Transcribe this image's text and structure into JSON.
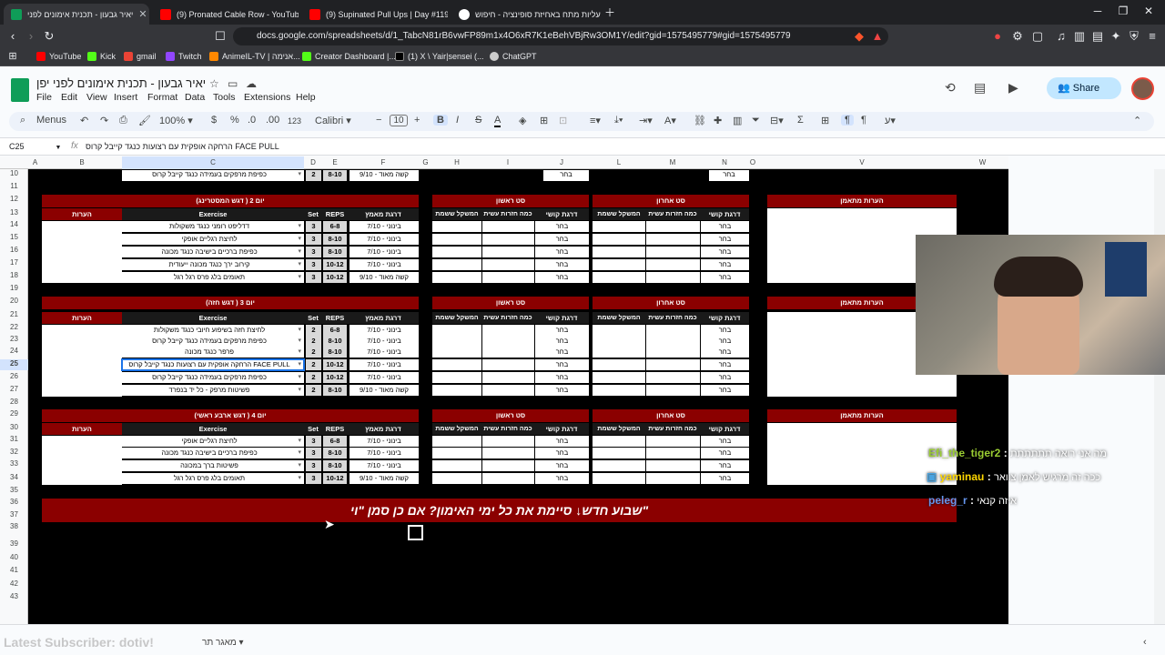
{
  "browser": {
    "tabs": [
      {
        "title": "יאיר גבעון - תכנית אימונים לפני",
        "color": "#0f9d58"
      },
      {
        "title": "(9) Pronated Cable Row - YouTube",
        "color": "#ff0000"
      },
      {
        "title": "(9) Supinated Pull Ups | Day #119 W",
        "color": "#ff0000"
      },
      {
        "title": "עליות מתח באחיזת סופינציה - חיפוש",
        "color": "#4285f4"
      }
    ],
    "url": "docs.google.com/spreadsheets/d/1_TabcN81rB6vwFP89m1x4O6xR7K1eBehVBjRw3OM1Y/edit?gid=1575495779#gid=1575495779",
    "bookmarks": [
      "YouTube",
      "Kick",
      "gmail",
      "Twitch",
      "AnimeIL-TV | אנימה...",
      "Creator Dashboard |...",
      "(1) X \\ Yair|sensei (...",
      "ChatGPT"
    ]
  },
  "sheets": {
    "title": "יאיר גבעון - תכנית אימונים לפני יפן",
    "menu": [
      "File",
      "Edit",
      "View",
      "Insert",
      "Format",
      "Data",
      "Tools",
      "Extensions",
      "Help"
    ],
    "share_label": "Share",
    "toolbar": {
      "menus": "Menus",
      "zoom": "100%",
      "currency": "$",
      "percent": "%",
      "dec1": ".0",
      "dec2": ".00",
      "num": "123",
      "font": "Calibri",
      "font_size": "10"
    },
    "cell_ref": "C25",
    "formula": "הרחקה אופקית עם רצועות כנגד קייבל קרוס FACE PULL",
    "columns": [
      "A",
      "B",
      "C",
      "D",
      "E",
      "F",
      "G",
      "H",
      "I",
      "J",
      "L",
      "M",
      "N",
      "O",
      "V",
      "W"
    ],
    "rows": [
      "10",
      "11",
      "12",
      "13",
      "14",
      "15",
      "16",
      "17",
      "18",
      "19",
      "20",
      "21",
      "22",
      "23",
      "24",
      "25",
      "26",
      "27",
      "28",
      "29",
      "30",
      "31",
      "32",
      "33",
      "34",
      "35",
      "36",
      "37",
      "38",
      "39",
      "40",
      "41",
      "42",
      "43"
    ],
    "headers": {
      "exercise": "Exercise",
      "set": "Set",
      "reps": "REPS",
      "effort": "דרגת מאמץ",
      "notes": "הערות",
      "first_set": "סט ראשון",
      "last_set": "סט אחרון",
      "weight": "המשקל ששמת",
      "reps_done": "כמה חזרות עשית",
      "difficulty": "דרגת קושי",
      "trainer_notes": "הערות מתאמן"
    },
    "row10": {
      "exercise": "כפיפת מרפקים בעמידה כנגד קייבל קרוס",
      "set": "2",
      "reps": "8-10",
      "effort": "קשה מאוד - 9/10",
      "choose": "בחר"
    },
    "day2": {
      "title": "יום 2 ( דגש המסטרינג)",
      "rows": [
        {
          "exercise": "דדליפט רומני כנגד משקולות",
          "set": "3",
          "reps": "6-8",
          "effort": "בינוני - 7/10",
          "choose": "בחר"
        },
        {
          "exercise": "לחיצת רגליים אופקי",
          "set": "3",
          "reps": "8-10",
          "effort": "בינוני - 7/10",
          "choose": "בחר"
        },
        {
          "exercise": "כפיפת ברכיים בישיבה כנגד מכונה",
          "set": "3",
          "reps": "8-10",
          "effort": "בינוני - 7/10",
          "choose": "בחר"
        },
        {
          "exercise": "קירוב ירך כנגד מכונה ייעודית",
          "set": "3",
          "reps": "10-12",
          "effort": "בינוני - 7/10",
          "choose": "בחר"
        },
        {
          "exercise": "תאומים בלג פרס רגל רגל",
          "set": "3",
          "reps": "10-12",
          "effort": "קשה מאוד - 9/10",
          "choose": "בחר"
        }
      ]
    },
    "day3": {
      "title": "יום 3 ( דגש חזה)",
      "rows": [
        {
          "exercise": "לחיצת חזה בשיפוע חיובי כנגד משקולות",
          "set": "2",
          "reps": "6-8",
          "effort": "בינוני - 7/10",
          "choose": "בחר"
        },
        {
          "exercise": "כפיפת מרפקים בעמידה כנגד קייבל קרוס",
          "set": "2",
          "reps": "8-10",
          "effort": "בינוני - 7/10",
          "choose": "בחר"
        },
        {
          "exercise": "פרפר כנגד מכונה",
          "set": "2",
          "reps": "8-10",
          "effort": "בינוני - 7/10",
          "choose": "בחר"
        },
        {
          "exercise": "הרחקה אופקית עם רצועות כנגד קייבל קרוס FACE PULL",
          "set": "2",
          "reps": "10-12",
          "effort": "בינוני - 7/10",
          "choose": "בחר"
        },
        {
          "exercise": "כפיפת מרפקים בעמידה כנגד קייבל קרוס",
          "set": "2",
          "reps": "10-12",
          "effort": "בינוני - 7/10",
          "choose": "בחר"
        },
        {
          "exercise": "פשיטות מרפק - כל יד בנפרד",
          "set": "2",
          "reps": "8-10",
          "effort": "קשה מאוד - 9/10",
          "choose": "בחר"
        }
      ]
    },
    "day4": {
      "title": "יום 4 ( דגש ארבע ראשי)",
      "rows": [
        {
          "exercise": "לחיצת רגליים אופקי",
          "set": "3",
          "reps": "6-8",
          "effort": "בינוני - 7/10",
          "choose": "בחר"
        },
        {
          "exercise": "כפיפת ברכיים בישיבה כנגד מכונה",
          "set": "3",
          "reps": "8-10",
          "effort": "בינוני - 7/10",
          "choose": "בחר"
        },
        {
          "exercise": "פשיטות ברך במכונה",
          "set": "3",
          "reps": "8-10",
          "effort": "בינוני - 7/10",
          "choose": "בחר"
        },
        {
          "exercise": "תאומים בלג פרס רגל רגל",
          "set": "3",
          "reps": "10-12",
          "effort": "קשה מאוד - 9/10",
          "choose": "בחר"
        }
      ]
    },
    "banner": "שבוע חדש↓ סיימת את כל ימי האימון? אם כן סמן \"וי\"",
    "sheet_tab": "מאגר תר",
    "watermark": "Latest Subscriber: dotiv!"
  },
  "chat": [
    {
      "user": "Efi_the_tiger2",
      "msg": "מה אני רואה תתתתתת",
      "color": "#9acd32"
    },
    {
      "user": "yaminau",
      "msg": "ככה זה מרגיש לאמן צוואר",
      "color": "#ffd700"
    },
    {
      "user": "peleg_r",
      "msg": "איזה קנאי",
      "color": "#6495ed"
    }
  ]
}
